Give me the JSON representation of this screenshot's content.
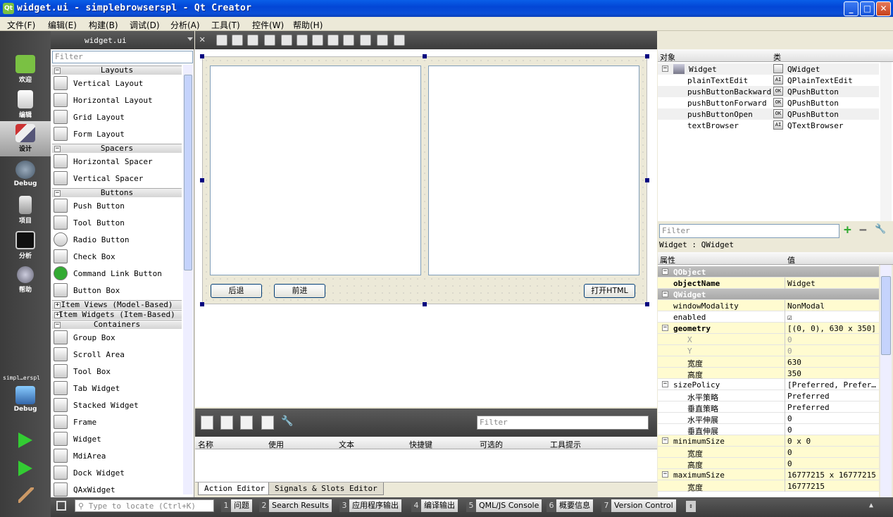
{
  "window": {
    "title": "widget.ui - simplebrowserspl - Qt Creator",
    "icon_text": "Qt",
    "min": "_",
    "max": "□",
    "close": "✕"
  },
  "menu": [
    "文件(F)",
    "编辑(E)",
    "构建(B)",
    "调试(D)",
    "分析(A)",
    "工具(T)",
    "控件(W)",
    "帮助(H)"
  ],
  "modes": [
    {
      "label": "欢迎",
      "icon": "qt-logo-icon"
    },
    {
      "label": "编辑",
      "icon": "edit-document-icon"
    },
    {
      "label": "设计",
      "icon": "design-brush-icon"
    },
    {
      "label": "Debug",
      "icon": "debug-bug-icon"
    },
    {
      "label": "项目",
      "icon": "project-icon"
    },
    {
      "label": "分析",
      "icon": "analyze-icon"
    },
    {
      "label": "帮助",
      "icon": "help-icon"
    }
  ],
  "kit": {
    "label": "simpl…erspl",
    "mode": "Debug"
  },
  "widgetbox": {
    "file": "widget.ui",
    "filter_placeholder": "Filter",
    "categories": {
      "layouts": "Layouts",
      "spacers": "Spacers",
      "buttons": "Buttons",
      "item_views": "Item Views (Model-Based)",
      "item_widgets": "Item Widgets (Item-Based)",
      "containers": "Containers"
    },
    "layouts": [
      "Vertical Layout",
      "Horizontal Layout",
      "Grid Layout",
      "Form Layout"
    ],
    "spacers": [
      "Horizontal Spacer",
      "Vertical Spacer"
    ],
    "buttons": [
      "Push Button",
      "Tool Button",
      "Radio Button",
      "Check Box",
      "Command Link Button",
      "Button Box"
    ],
    "containers": [
      "Group Box",
      "Scroll Area",
      "Tool Box",
      "Tab Widget",
      "Stacked Widget",
      "Frame",
      "Widget",
      "MdiArea",
      "Dock Widget",
      "QAxWidget"
    ]
  },
  "form": {
    "btn_back": "后退",
    "btn_forward": "前进",
    "btn_open": "打开HTML"
  },
  "action_editor": {
    "filter_placeholder": "Filter",
    "columns": [
      "名称",
      "使用",
      "文本",
      "快捷键",
      "可选的",
      "工具提示"
    ],
    "tabs": [
      "Action Editor",
      "Signals & Slots Editor"
    ]
  },
  "object_inspector": {
    "columns": [
      "对象",
      "类"
    ],
    "rows": [
      {
        "name": "Widget",
        "cls": "QWidget"
      },
      {
        "name": "plainTextEdit",
        "cls": "QPlainTextEdit"
      },
      {
        "name": "pushButtonBackward",
        "cls": "QPushButton"
      },
      {
        "name": "pushButtonForward",
        "cls": "QPushButton"
      },
      {
        "name": "pushButtonOpen",
        "cls": "QPushButton"
      },
      {
        "name": "textBrowser",
        "cls": "QTextBrowser"
      }
    ]
  },
  "property_editor": {
    "filter_placeholder": "Filter",
    "caption": "Widget : QWidget",
    "columns": [
      "属性",
      "值"
    ],
    "rows": [
      {
        "k": "QObject",
        "v": "",
        "type": "grp"
      },
      {
        "k": "objectName",
        "v": "Widget",
        "type": "y",
        "bold": true
      },
      {
        "k": "QWidget",
        "v": "",
        "type": "grp"
      },
      {
        "k": "windowModality",
        "v": "NonModal",
        "type": "y"
      },
      {
        "k": "enabled",
        "v": "☑",
        "type": "g"
      },
      {
        "k": "geometry",
        "v": "[(0, 0), 630 x 350]",
        "type": "y",
        "bold": true,
        "toggle": "−"
      },
      {
        "k": "X",
        "v": "0",
        "type": "y",
        "sub": true,
        "dim": true
      },
      {
        "k": "Y",
        "v": "0",
        "type": "y",
        "sub": true,
        "dim": true
      },
      {
        "k": "宽度",
        "v": "630",
        "type": "y",
        "sub": true
      },
      {
        "k": "高度",
        "v": "350",
        "type": "y",
        "sub": true
      },
      {
        "k": "sizePolicy",
        "v": "[Preferred, Prefer…",
        "type": "g",
        "toggle": "−"
      },
      {
        "k": "水平策略",
        "v": "Preferred",
        "type": "g",
        "sub": true
      },
      {
        "k": "垂直策略",
        "v": "Preferred",
        "type": "g",
        "sub": true
      },
      {
        "k": "水平伸展",
        "v": "0",
        "type": "g",
        "sub": true
      },
      {
        "k": "垂直伸展",
        "v": "0",
        "type": "g",
        "sub": true
      },
      {
        "k": "minimumSize",
        "v": "0 x 0",
        "type": "y",
        "toggle": "−"
      },
      {
        "k": "宽度",
        "v": "0",
        "type": "y",
        "sub": true
      },
      {
        "k": "高度",
        "v": "0",
        "type": "y",
        "sub": true
      },
      {
        "k": "maximumSize",
        "v": "16777215 x 16777215",
        "type": "y",
        "toggle": "−"
      },
      {
        "k": "宽度",
        "v": "16777215",
        "type": "y",
        "sub": true
      }
    ]
  },
  "statusbar": {
    "locate_placeholder": "Type to locate (Ctrl+K)",
    "panes": [
      {
        "n": "1",
        "t": "问题"
      },
      {
        "n": "2",
        "t": "Search Results"
      },
      {
        "n": "3",
        "t": "应用程序输出"
      },
      {
        "n": "4",
        "t": "编译输出"
      },
      {
        "n": "5",
        "t": "QML/JS Console"
      },
      {
        "n": "6",
        "t": "概要信息"
      },
      {
        "n": "7",
        "t": "Version Control"
      }
    ]
  }
}
